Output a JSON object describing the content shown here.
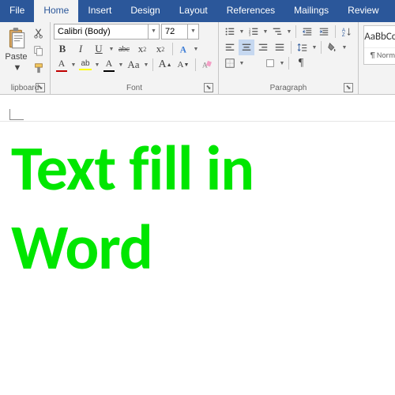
{
  "tabs": {
    "file": "File",
    "home": "Home",
    "insert": "Insert",
    "design": "Design",
    "layout": "Layout",
    "references": "References",
    "mailings": "Mailings",
    "review": "Review"
  },
  "clipboard": {
    "label": "lipboard",
    "paste": "Paste"
  },
  "font": {
    "name": "Calibri (Body)",
    "size": "72",
    "label": "Font",
    "bold": "B",
    "italic": "I",
    "underline": "U",
    "strike": "abc",
    "sub": "x",
    "sup": "x",
    "caseAa": "Aa",
    "growA": "A",
    "shrinkA": "A"
  },
  "paragraph": {
    "label": "Paragraph"
  },
  "styles": {
    "sample": "AaBbCcDc",
    "name": "¶ Normal"
  },
  "document": {
    "text": "Text fill in Word"
  }
}
